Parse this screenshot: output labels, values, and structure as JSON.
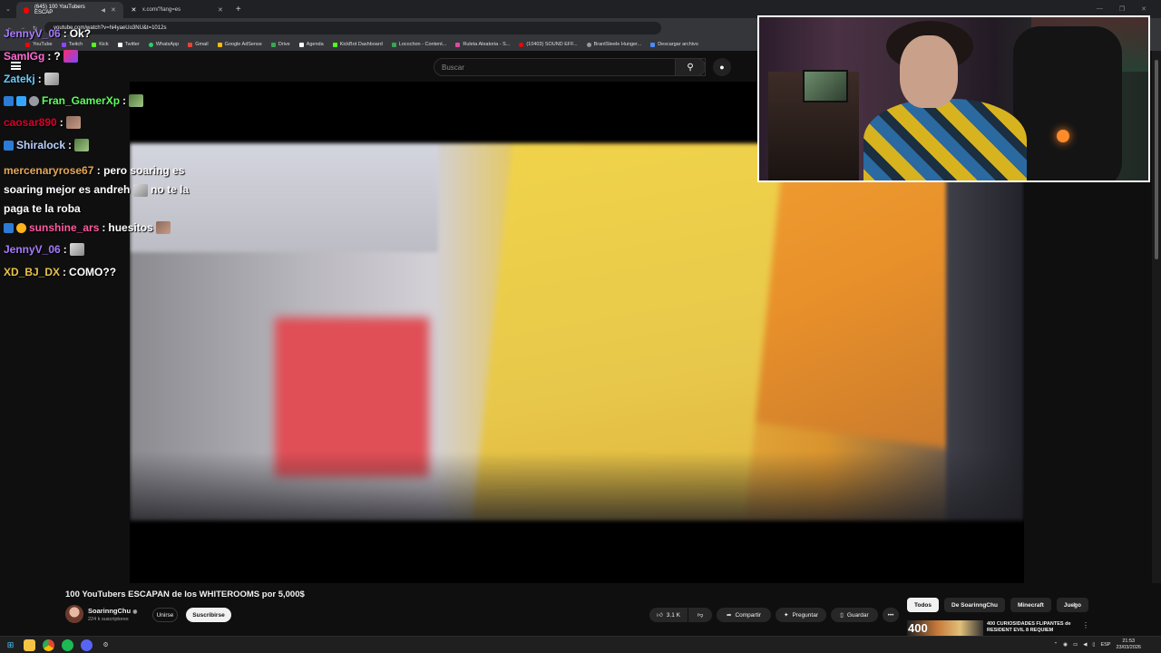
{
  "browser": {
    "tabs": [
      {
        "title": "(645) 100 YouTubers ESCAP",
        "icon": "youtube-icon",
        "active": true
      },
      {
        "title": "x.com/?lang=es",
        "icon": "x-icon",
        "active": false
      }
    ],
    "address": "youtube.com/watch?v=hi4yaeUo3NU&t=1012s",
    "bookmarks": [
      "YouTube",
      "Twitch",
      "Kick",
      "Twitter",
      "WhatsApp",
      "Gmail",
      "Google AdSense",
      "Drive",
      "Agenda",
      "KickBot Dashboard",
      "Locochon - Content...",
      "Ruleta Aleatoria - S...",
      "(10403) SOUND EFF...",
      "BrantSteele Hunger...",
      "Descargar archivo"
    ]
  },
  "youtube": {
    "search_placeholder": "Buscar",
    "video_title": "100 YouTubers ESCAPAN de los WHITEROOMS por 5,000$",
    "channel": {
      "name": "SoarinngChu",
      "verified": "◉",
      "subscribers": "224 k suscriptores"
    },
    "join_label": "Unirse",
    "subscribe_label": "Suscribirse",
    "like_count": "3.1 K",
    "share_label": "Compartir",
    "ask_label": "Preguntar",
    "save_label": "Guardar",
    "chips": [
      "Todos",
      "De SoarinngChu",
      "Minecraft",
      "Juego"
    ],
    "rec_title": "400 CURIOSIDADES FLIPANTES de RESIDENT EVIL 8 REQUIEM",
    "rec_thumb_text": "400"
  },
  "chat": [
    {
      "user": "JennyV_06",
      "text": "Ok?",
      "color": "#a77bff"
    },
    {
      "user": "SamIGg",
      "text": "?",
      "color": "#ff6ad5"
    },
    {
      "user": "Zatekj",
      "text": "",
      "color": "#66ccff"
    },
    {
      "user": "Fran_GamerXp",
      "text": "",
      "color": "#5cff5c"
    },
    {
      "user": "caosar890",
      "text": "",
      "color": "#d9002c"
    },
    {
      "user": "Shiralock",
      "text": "",
      "color": "#b8d0ff"
    },
    {
      "user": "mercenaryrose67",
      "text": "pero soaring es soaring mejor es andreh",
      "text2": "no te la paga te la roba",
      "color": "#e5a85a"
    },
    {
      "user": "sunshine_ars",
      "text": "huesitos",
      "color": "#ff5aa0"
    },
    {
      "user": "JennyV_06",
      "text": "",
      "color": "#a77bff"
    },
    {
      "user": "XD_BJ_DX",
      "text": "COMO??",
      "color": "#e8c24a"
    }
  ],
  "taskbar": {
    "lang": "ESP",
    "time": "21:53",
    "date": "23/03/2026"
  }
}
